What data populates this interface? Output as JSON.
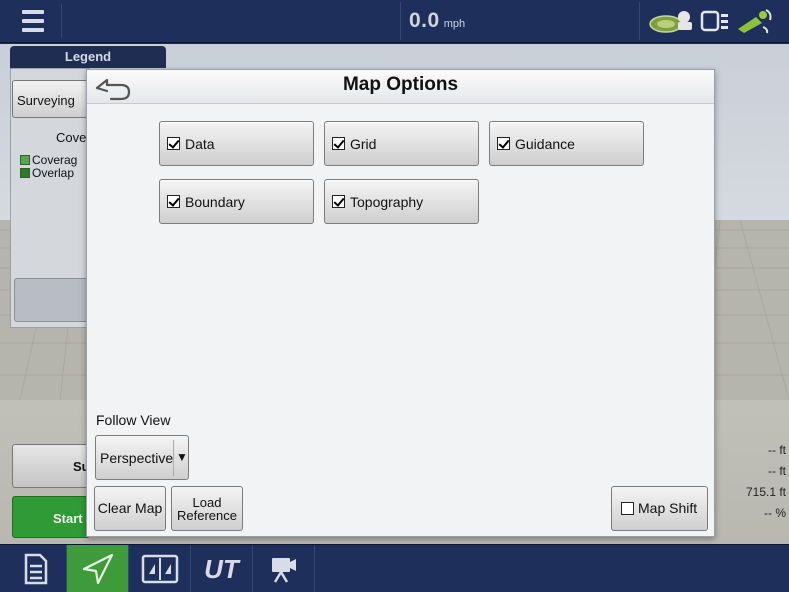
{
  "topbar": {
    "speed_value": "0.0",
    "speed_unit": "mph",
    "icons": [
      "menu-icon",
      "gps-receiver-icon",
      "device-link-icon",
      "satellite-signal-icon"
    ]
  },
  "left_panel": {
    "legend_tab": "Legend",
    "surveying_button": "Surveying",
    "coverage_label": "Cove",
    "legend_items": [
      {
        "label": "Coverag",
        "color": "#59a44e"
      },
      {
        "label": "Overlap",
        "color": "#2f7a2a"
      }
    ],
    "lower_button_label": "Su",
    "start_button_label": "Start"
  },
  "stats": {
    "values": [
      "-- ft",
      "-- ft",
      "715.1 ft",
      "-- %"
    ]
  },
  "dialog": {
    "title": "Map Options",
    "options": [
      {
        "label": "Data",
        "checked": true
      },
      {
        "label": "Grid",
        "checked": true
      },
      {
        "label": "Guidance",
        "checked": true
      },
      {
        "label": "Boundary",
        "checked": true
      },
      {
        "label": "Topography",
        "checked": true
      }
    ],
    "follow_view_label": "Follow View",
    "follow_view_value": "Perspective",
    "clear_map_label": "Clear Map",
    "load_reference_line1": "Load",
    "load_reference_line2": "Reference",
    "map_shift_label": "Map Shift",
    "map_shift_checked": false
  },
  "bottombar": {
    "items": [
      "document-icon",
      "map-navigation-icon",
      "split-view-icon",
      "ut-icon",
      "camera-icon"
    ],
    "ut_label": "UT"
  },
  "colors": {
    "nav_bar": "#1e2f5c",
    "active_tab": "#3e9a3a",
    "start_button": "#2e9b36"
  }
}
